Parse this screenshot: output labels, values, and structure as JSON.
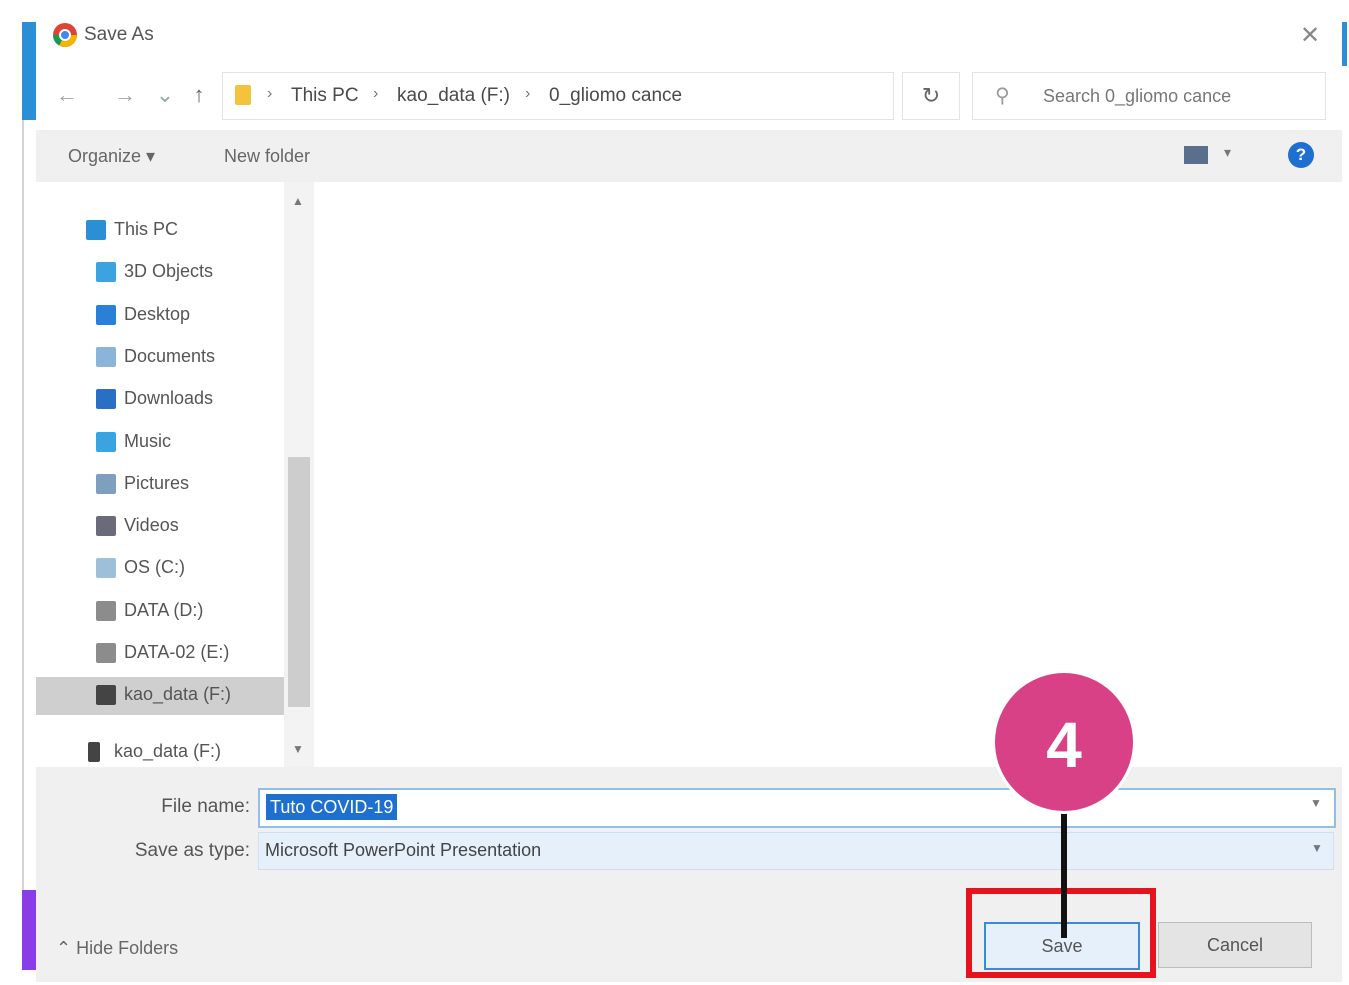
{
  "window": {
    "title": "Save As",
    "close_symbol": "✕"
  },
  "nav_buttons": {
    "back": "←",
    "forward": "→",
    "recent": "⌄",
    "up": "↑"
  },
  "address": {
    "crumbs": [
      "This PC",
      "kao_data (F:)",
      "0_gliomo cance"
    ],
    "separator": "›",
    "dropdown": "⌄",
    "refresh": "↻"
  },
  "search": {
    "placeholder": "Search 0_gliomo cance",
    "icon": "search-icon"
  },
  "toolbar": {
    "organize": "Organize ▾",
    "new_folder": "New folder",
    "view_dropdown": "▾",
    "help": "?"
  },
  "sidebar": {
    "items": [
      {
        "label": "This PC",
        "icon": "pc-icon",
        "color": "#2a8fd6"
      },
      {
        "label": "3D Objects",
        "icon": "cube-icon",
        "color": "#3aa3e0"
      },
      {
        "label": "Desktop",
        "icon": "desktop-icon",
        "color": "#2a7fd6"
      },
      {
        "label": "Documents",
        "icon": "document-icon",
        "color": "#8ab4d8"
      },
      {
        "label": "Downloads",
        "icon": "download-icon",
        "color": "#2a6fc6"
      },
      {
        "label": "Music",
        "icon": "music-icon",
        "color": "#3aa3e0"
      },
      {
        "label": "Pictures",
        "icon": "picture-icon",
        "color": "#7f9fbf"
      },
      {
        "label": "Videos",
        "icon": "video-icon",
        "color": "#6a6a7a"
      },
      {
        "label": "OS (C:)",
        "icon": "drive-icon",
        "color": "#9fbfd8"
      },
      {
        "label": "DATA (D:)",
        "icon": "drive-icon",
        "color": "#8c8c8c"
      },
      {
        "label": "DATA-02 (E:)",
        "icon": "drive-icon",
        "color": "#8c8c8c"
      },
      {
        "label": "kao_data (F:)",
        "icon": "usb-drive-icon",
        "color": "#444444"
      }
    ],
    "bottom_item": {
      "label": "kao_data (F:)",
      "icon": "usb-drive-icon"
    }
  },
  "form": {
    "file_name_label": "File name:",
    "file_name_value": "Tuto COVID-19",
    "save_type_label": "Save as type:",
    "save_type_value": "Microsoft PowerPoint Presentation"
  },
  "footer": {
    "hide_folders": "⌃  Hide Folders",
    "save": "Save",
    "cancel": "Cancel"
  },
  "annotation": {
    "step_number": "4",
    "highlight_color": "#e8121f",
    "circle_color": "#d94187"
  }
}
